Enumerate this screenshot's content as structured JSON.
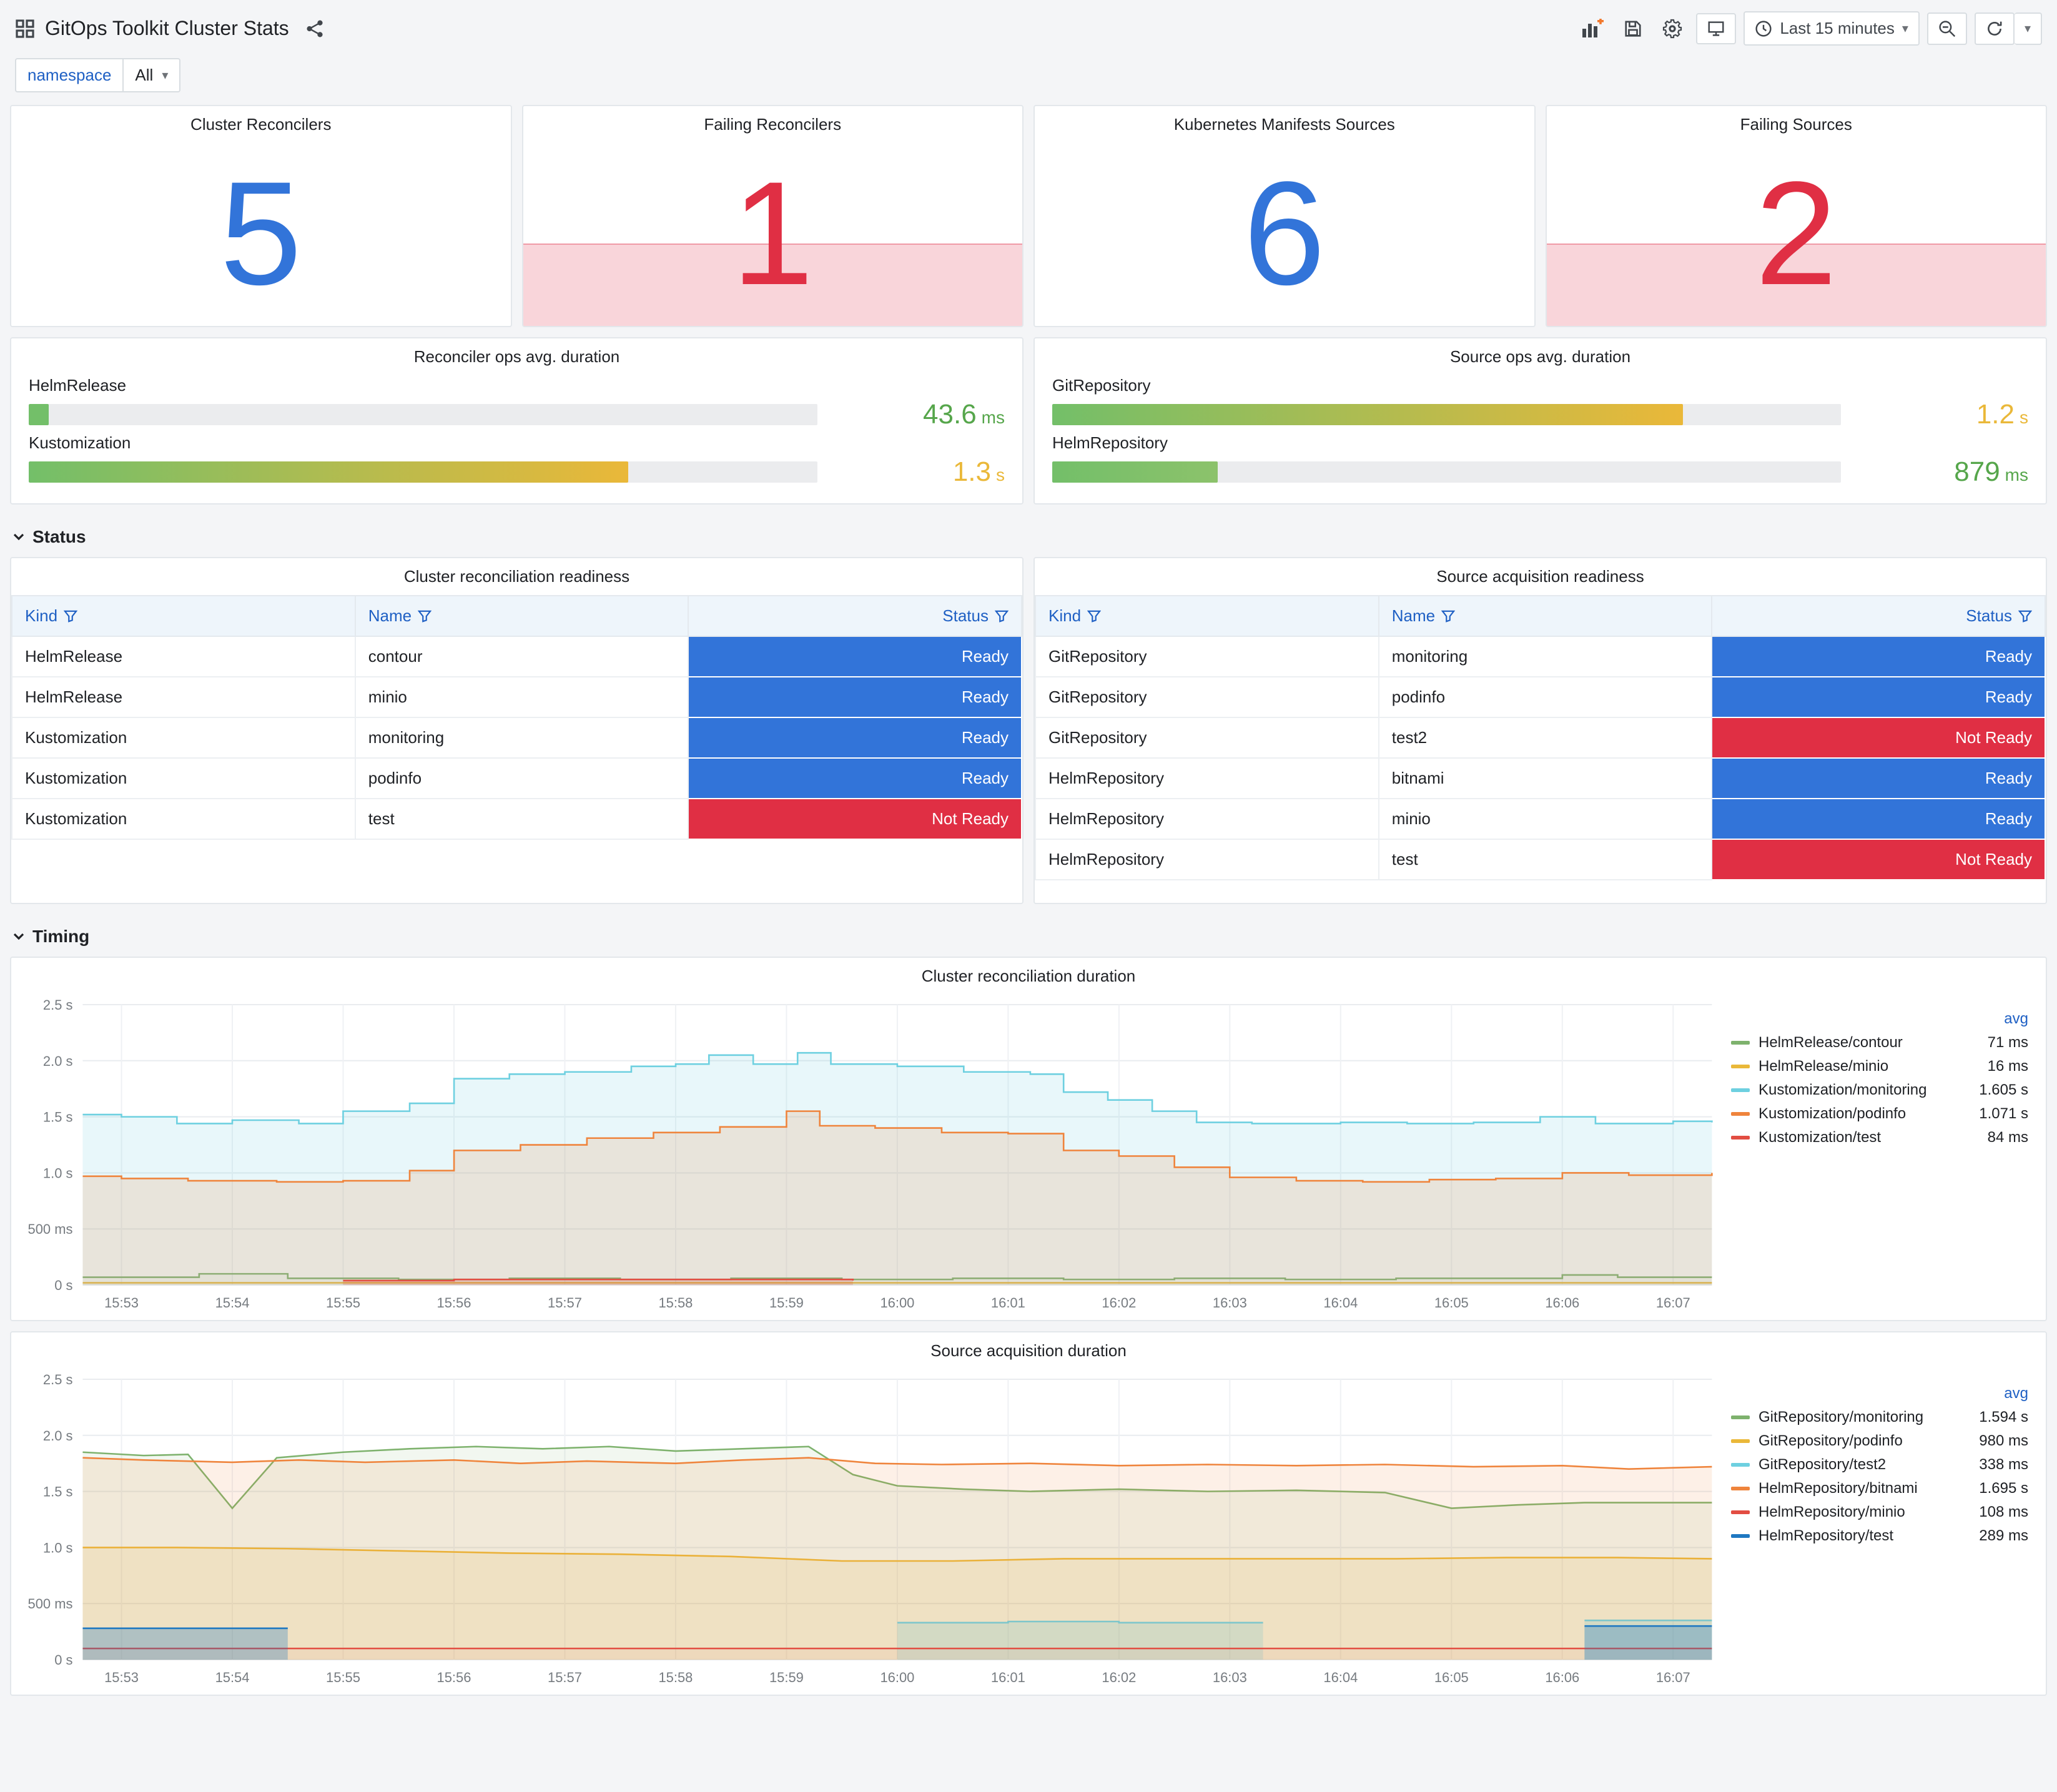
{
  "header": {
    "title": "GitOps Toolkit Cluster Stats",
    "time_label": "Last 15 minutes"
  },
  "variables": {
    "name": "namespace",
    "value": "All"
  },
  "sections": {
    "status": "Status",
    "timing": "Timing"
  },
  "colors": {
    "stat_ok": "#3274D9",
    "stat_alert": "#E02F44",
    "ready_bg": "#3274D9",
    "not_ready_bg": "#E02F44",
    "green": "#56A64B",
    "amber": "#EAB839"
  },
  "stat_panels": [
    {
      "title": "Cluster Reconcilers",
      "value": "5",
      "state": "ok"
    },
    {
      "title": "Failing Reconcilers",
      "value": "1",
      "state": "alert"
    },
    {
      "title": "Kubernetes Manifests Sources",
      "value": "6",
      "state": "ok"
    },
    {
      "title": "Failing Sources",
      "value": "2",
      "state": "alert"
    }
  ],
  "gauge_panels": [
    {
      "title": "Reconciler ops avg. duration",
      "bars": [
        {
          "label": "HelmRelease",
          "value": "43.6",
          "unit": "ms",
          "pct": 2.5,
          "color_from": "#73BF69",
          "color_to": "#73BF69",
          "value_color": "#56A64B"
        },
        {
          "label": "Kustomization",
          "value": "1.3",
          "unit": "s",
          "pct": 76,
          "color_from": "#73BF69",
          "color_to": "#EAB839",
          "value_color": "#EAB839"
        }
      ]
    },
    {
      "title": "Source ops avg. duration",
      "bars": [
        {
          "label": "GitRepository",
          "value": "1.2",
          "unit": "s",
          "pct": 80,
          "color_from": "#73BF69",
          "color_to": "#EAB839",
          "value_color": "#EAB839"
        },
        {
          "label": "HelmRepository",
          "value": "879",
          "unit": "ms",
          "pct": 21,
          "color_from": "#73BF69",
          "color_to": "#8CC26B",
          "value_color": "#56A64B"
        }
      ]
    }
  ],
  "status_colors": {
    "Ready": "#3274D9",
    "Not Ready": "#E02F44"
  },
  "tables": [
    {
      "title": "Cluster reconciliation readiness",
      "columns": [
        "Kind",
        "Name",
        "Status"
      ],
      "rows": [
        [
          "HelmRelease",
          "contour",
          "Ready"
        ],
        [
          "HelmRelease",
          "minio",
          "Ready"
        ],
        [
          "Kustomization",
          "monitoring",
          "Ready"
        ],
        [
          "Kustomization",
          "podinfo",
          "Ready"
        ],
        [
          "Kustomization",
          "test",
          "Not Ready"
        ]
      ]
    },
    {
      "title": "Source acquisition readiness",
      "columns": [
        "Kind",
        "Name",
        "Status"
      ],
      "rows": [
        [
          "GitRepository",
          "monitoring",
          "Ready"
        ],
        [
          "GitRepository",
          "podinfo",
          "Ready"
        ],
        [
          "GitRepository",
          "test2",
          "Not Ready"
        ],
        [
          "HelmRepository",
          "bitnami",
          "Ready"
        ],
        [
          "HelmRepository",
          "minio",
          "Ready"
        ],
        [
          "HelmRepository",
          "test",
          "Not Ready"
        ]
      ]
    }
  ],
  "chart_data": [
    {
      "type": "line",
      "title": "Cluster reconciliation duration",
      "xlim": [
        52.65,
        67.35
      ],
      "ylim": [
        0,
        2.5
      ],
      "legend_value_header": "avg",
      "yticks": [
        {
          "v": 0,
          "label": "0 s"
        },
        {
          "v": 0.5,
          "label": "500 ms"
        },
        {
          "v": 1,
          "label": "1.0 s"
        },
        {
          "v": 1.5,
          "label": "1.5 s"
        },
        {
          "v": 2,
          "label": "2.0 s"
        },
        {
          "v": 2.5,
          "label": "2.5 s"
        }
      ],
      "xticks": [
        {
          "v": 53,
          "label": "15:53"
        },
        {
          "v": 54,
          "label": "15:54"
        },
        {
          "v": 55,
          "label": "15:55"
        },
        {
          "v": 56,
          "label": "15:56"
        },
        {
          "v": 57,
          "label": "15:57"
        },
        {
          "v": 58,
          "label": "15:58"
        },
        {
          "v": 59,
          "label": "15:59"
        },
        {
          "v": 60,
          "label": "16:00"
        },
        {
          "v": 61,
          "label": "16:01"
        },
        {
          "v": 62,
          "label": "16:02"
        },
        {
          "v": 63,
          "label": "16:03"
        },
        {
          "v": 64,
          "label": "16:04"
        },
        {
          "v": 65,
          "label": "16:05"
        },
        {
          "v": 66,
          "label": "16:06"
        },
        {
          "v": 67,
          "label": "16:07"
        }
      ],
      "series": [
        {
          "name": "HelmRelease/contour",
          "avg": "71 ms",
          "color": "#7EB26D",
          "fill": 0.05,
          "step": true,
          "points": [
            [
              52.65,
              0.07
            ],
            [
              53,
              0.07
            ],
            [
              53.7,
              0.1
            ],
            [
              54.2,
              0.1
            ],
            [
              54.5,
              0.06
            ],
            [
              55.5,
              0.05
            ],
            [
              56.5,
              0.06
            ],
            [
              57.5,
              0.05
            ],
            [
              58.5,
              0.06
            ],
            [
              59.5,
              0.05
            ],
            [
              60.5,
              0.06
            ],
            [
              61.5,
              0.05
            ],
            [
              62.5,
              0.06
            ],
            [
              63.5,
              0.05
            ],
            [
              64.5,
              0.06
            ],
            [
              65.5,
              0.06
            ],
            [
              66,
              0.09
            ],
            [
              66.5,
              0.07
            ],
            [
              67.35,
              0.07
            ]
          ]
        },
        {
          "name": "HelmRelease/minio",
          "avg": "16 ms",
          "color": "#EAB839",
          "fill": 0.03,
          "step": true,
          "points": [
            [
              52.65,
              0.02
            ],
            [
              67.35,
              0.02
            ]
          ]
        },
        {
          "name": "Kustomization/monitoring",
          "avg": "1.605 s",
          "color": "#6ED0E0",
          "fill": 0.16,
          "step": true,
          "points": [
            [
              52.65,
              1.52
            ],
            [
              53,
              1.5
            ],
            [
              53.5,
              1.44
            ],
            [
              54,
              1.47
            ],
            [
              54.6,
              1.44
            ],
            [
              55,
              1.55
            ],
            [
              55.6,
              1.62
            ],
            [
              56,
              1.84
            ],
            [
              56.5,
              1.88
            ],
            [
              57,
              1.9
            ],
            [
              57.6,
              1.95
            ],
            [
              58,
              1.97
            ],
            [
              58.3,
              2.05
            ],
            [
              58.7,
              1.97
            ],
            [
              59.1,
              2.07
            ],
            [
              59.4,
              1.97
            ],
            [
              60,
              1.95
            ],
            [
              60.6,
              1.9
            ],
            [
              61.2,
              1.88
            ],
            [
              61.5,
              1.72
            ],
            [
              61.9,
              1.65
            ],
            [
              62.3,
              1.55
            ],
            [
              62.7,
              1.45
            ],
            [
              63.2,
              1.44
            ],
            [
              64,
              1.45
            ],
            [
              64.6,
              1.44
            ],
            [
              65.2,
              1.45
            ],
            [
              65.8,
              1.5
            ],
            [
              66.3,
              1.44
            ],
            [
              67,
              1.46
            ],
            [
              67.35,
              1.45
            ]
          ]
        },
        {
          "name": "Kustomization/podinfo",
          "avg": "1.071 s",
          "color": "#EF843C",
          "fill": 0.16,
          "step": true,
          "points": [
            [
              52.65,
              0.97
            ],
            [
              53,
              0.95
            ],
            [
              53.6,
              0.93
            ],
            [
              54.4,
              0.92
            ],
            [
              55,
              0.93
            ],
            [
              55.6,
              1.02
            ],
            [
              56,
              1.2
            ],
            [
              56.6,
              1.25
            ],
            [
              57.2,
              1.31
            ],
            [
              57.8,
              1.36
            ],
            [
              58.4,
              1.41
            ],
            [
              59,
              1.55
            ],
            [
              59.3,
              1.42
            ],
            [
              59.8,
              1.4
            ],
            [
              60.4,
              1.36
            ],
            [
              61,
              1.35
            ],
            [
              61.5,
              1.2
            ],
            [
              62,
              1.15
            ],
            [
              62.5,
              1.05
            ],
            [
              63,
              0.96
            ],
            [
              63.6,
              0.93
            ],
            [
              64.2,
              0.92
            ],
            [
              64.8,
              0.94
            ],
            [
              65.4,
              0.95
            ],
            [
              66,
              1.0
            ],
            [
              66.6,
              0.98
            ],
            [
              67.35,
              1.0
            ]
          ]
        },
        {
          "name": "Kustomization/test",
          "avg": "84 ms",
          "color": "#E24D42",
          "fill": 0.2,
          "step": true,
          "points": [
            [
              55,
              0.04
            ],
            [
              56,
              0.05
            ],
            [
              57,
              0.05
            ],
            [
              58,
              0.05
            ],
            [
              59,
              0.05
            ],
            [
              59.6,
              0.04
            ]
          ]
        }
      ]
    },
    {
      "type": "line",
      "title": "Source acquisition duration",
      "xlim": [
        52.65,
        67.35
      ],
      "ylim": [
        0,
        2.5
      ],
      "legend_value_header": "avg",
      "yticks": [
        {
          "v": 0,
          "label": "0 s"
        },
        {
          "v": 0.5,
          "label": "500 ms"
        },
        {
          "v": 1,
          "label": "1.0 s"
        },
        {
          "v": 1.5,
          "label": "1.5 s"
        },
        {
          "v": 2,
          "label": "2.0 s"
        },
        {
          "v": 2.5,
          "label": "2.5 s"
        }
      ],
      "xticks": [
        {
          "v": 53,
          "label": "15:53"
        },
        {
          "v": 54,
          "label": "15:54"
        },
        {
          "v": 55,
          "label": "15:55"
        },
        {
          "v": 56,
          "label": "15:56"
        },
        {
          "v": 57,
          "label": "15:57"
        },
        {
          "v": 58,
          "label": "15:58"
        },
        {
          "v": 59,
          "label": "15:59"
        },
        {
          "v": 60,
          "label": "16:00"
        },
        {
          "v": 61,
          "label": "16:01"
        },
        {
          "v": 62,
          "label": "16:02"
        },
        {
          "v": 63,
          "label": "16:03"
        },
        {
          "v": 64,
          "label": "16:04"
        },
        {
          "v": 65,
          "label": "16:05"
        },
        {
          "v": 66,
          "label": "16:06"
        },
        {
          "v": 67,
          "label": "16:07"
        }
      ],
      "series": [
        {
          "name": "GitRepository/monitoring",
          "avg": "1.594 s",
          "color": "#7EB26D",
          "fill": 0.1,
          "step": false,
          "points": [
            [
              52.65,
              1.85
            ],
            [
              53.2,
              1.82
            ],
            [
              53.6,
              1.83
            ],
            [
              54,
              1.35
            ],
            [
              54.4,
              1.8
            ],
            [
              55,
              1.85
            ],
            [
              55.6,
              1.88
            ],
            [
              56.2,
              1.9
            ],
            [
              56.8,
              1.88
            ],
            [
              57.4,
              1.9
            ],
            [
              58,
              1.86
            ],
            [
              58.6,
              1.88
            ],
            [
              59.2,
              1.9
            ],
            [
              59.6,
              1.65
            ],
            [
              60,
              1.55
            ],
            [
              60.6,
              1.52
            ],
            [
              61.2,
              1.5
            ],
            [
              62,
              1.52
            ],
            [
              62.8,
              1.5
            ],
            [
              63.6,
              1.51
            ],
            [
              64.4,
              1.49
            ],
            [
              65,
              1.35
            ],
            [
              65.6,
              1.38
            ],
            [
              66.2,
              1.4
            ],
            [
              67.35,
              1.4
            ]
          ]
        },
        {
          "name": "GitRepository/podinfo",
          "avg": "980 ms",
          "color": "#EAB839",
          "fill": 0.14,
          "step": false,
          "points": [
            [
              52.65,
              1.0
            ],
            [
              53.5,
              1.0
            ],
            [
              54.5,
              0.99
            ],
            [
              55.5,
              0.97
            ],
            [
              56.5,
              0.95
            ],
            [
              57.5,
              0.94
            ],
            [
              58.5,
              0.92
            ],
            [
              59.5,
              0.88
            ],
            [
              60.5,
              0.88
            ],
            [
              61.5,
              0.9
            ],
            [
              62.5,
              0.9
            ],
            [
              63.5,
              0.9
            ],
            [
              64.5,
              0.9
            ],
            [
              65.5,
              0.91
            ],
            [
              66.5,
              0.91
            ],
            [
              67.35,
              0.9
            ]
          ]
        },
        {
          "name": "GitRepository/test2",
          "avg": "338 ms",
          "color": "#6ED0E0",
          "fill": 0.25,
          "step": true,
          "points": [
            [
              60,
              0.33
            ],
            [
              61,
              0.34
            ],
            [
              62,
              0.33
            ],
            [
              63.3,
              0.33
            ],
            null,
            [
              66.2,
              0.35
            ],
            [
              67.35,
              0.35
            ]
          ]
        },
        {
          "name": "HelmRepository/bitnami",
          "avg": "1.695 s",
          "color": "#EF843C",
          "fill": 0.12,
          "step": false,
          "points": [
            [
              52.65,
              1.8
            ],
            [
              53.2,
              1.78
            ],
            [
              54,
              1.76
            ],
            [
              54.6,
              1.78
            ],
            [
              55.2,
              1.76
            ],
            [
              56,
              1.78
            ],
            [
              56.6,
              1.75
            ],
            [
              57.2,
              1.77
            ],
            [
              58,
              1.75
            ],
            [
              58.6,
              1.78
            ],
            [
              59.2,
              1.8
            ],
            [
              59.8,
              1.75
            ],
            [
              60.4,
              1.74
            ],
            [
              61.2,
              1.75
            ],
            [
              62,
              1.73
            ],
            [
              62.8,
              1.74
            ],
            [
              63.6,
              1.73
            ],
            [
              64.4,
              1.74
            ],
            [
              65.2,
              1.72
            ],
            [
              66,
              1.73
            ],
            [
              66.6,
              1.7
            ],
            [
              67.35,
              1.72
            ]
          ]
        },
        {
          "name": "HelmRepository/minio",
          "avg": "108 ms",
          "color": "#E24D42",
          "fill": 0.05,
          "step": false,
          "points": [
            [
              52.65,
              0.1
            ],
            [
              67.35,
              0.1
            ]
          ]
        },
        {
          "name": "HelmRepository/test",
          "avg": "289 ms",
          "color": "#1F78C1",
          "fill": 0.3,
          "step": true,
          "points": [
            [
              52.65,
              0.28
            ],
            [
              54.5,
              0.28
            ],
            null,
            [
              66.2,
              0.3
            ],
            [
              67.35,
              0.3
            ]
          ]
        }
      ]
    }
  ]
}
